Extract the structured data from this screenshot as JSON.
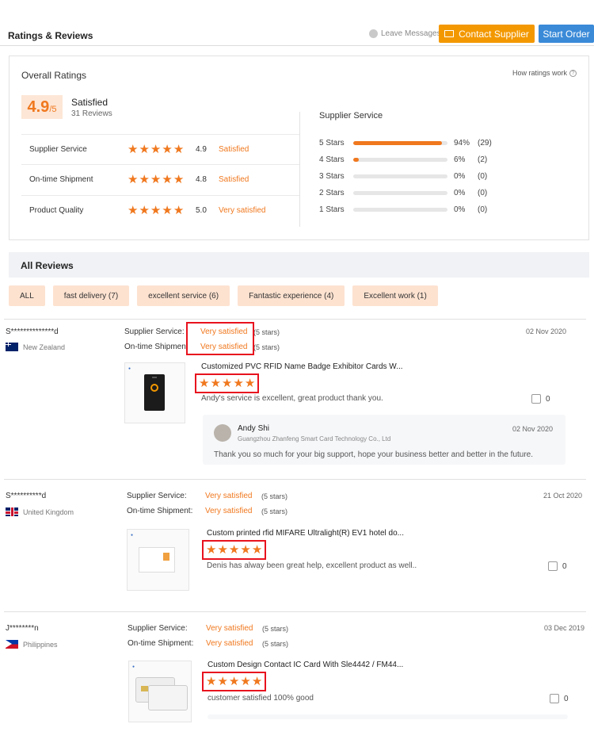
{
  "header": {
    "title": "Ratings & Reviews",
    "leave_messages": "Leave Messages",
    "contact_supplier": "Contact Supplier",
    "start_order": "Start Order"
  },
  "overall": {
    "title": "Overall Ratings",
    "how_ratings_work": "How ratings work",
    "score": "4.9",
    "score_max": "/5",
    "score_label": "Satisfied",
    "reviews_count": "31 Reviews",
    "ratings": [
      {
        "label": "Supplier Service",
        "score": "4.9",
        "desc": "Satisfied",
        "stars": 5
      },
      {
        "label": "On-time Shipment",
        "score": "4.8",
        "desc": "Satisfied",
        "stars": 5
      },
      {
        "label": "Product Quality",
        "score": "5.0",
        "desc": "Very satisfied",
        "stars": 5
      }
    ],
    "service_title": "Supplier Service",
    "distribution": [
      {
        "label": "5 Stars",
        "percent": 94,
        "percent_text": "94%",
        "count": "(29)"
      },
      {
        "label": "4 Stars",
        "percent": 6,
        "percent_text": "6%",
        "count": "(2)"
      },
      {
        "label": "3 Stars",
        "percent": 0,
        "percent_text": "0%",
        "count": "(0)"
      },
      {
        "label": "2 Stars",
        "percent": 0,
        "percent_text": "0%",
        "count": "(0)"
      },
      {
        "label": "1 Stars",
        "percent": 0,
        "percent_text": "0%",
        "count": "(0)"
      }
    ]
  },
  "all_reviews": {
    "title": "All Reviews",
    "filters": [
      "ALL",
      "fast delivery (7)",
      "excellent service (6)",
      "Fantastic experience (4)",
      "Excellent work (1)"
    ]
  },
  "reviews": [
    {
      "name": "S**************d",
      "country": "New Zealand",
      "supplier_service_label": "Supplier Service:",
      "supplier_service_value": "Very satisfied",
      "supplier_service_stars": "(5 stars)",
      "shipment_label": "On-time Shipment:",
      "shipment_value": "Very satisfied",
      "shipment_stars": "(5 stars)",
      "date": "02 Nov 2020",
      "product_title": "Customized PVC RFID Name Badge Exhibitor Cards W...",
      "rating": 5,
      "text": "Andy's service is excellent, great product thank you.",
      "likes": "0",
      "reply": {
        "name": "Andy Shi",
        "company": "Guangzhou Zhanfeng Smart Card Technology Co., Ltd",
        "date": "02 Nov 2020",
        "text": "Thank you so much for your big support, hope your business better and better in the future."
      }
    },
    {
      "name": "S**********d",
      "country": "United Kingdom",
      "supplier_service_label": "Supplier Service:",
      "supplier_service_value": "Very satisfied",
      "supplier_service_stars": "(5 stars)",
      "shipment_label": "On-time Shipment:",
      "shipment_value": "Very satisfied",
      "shipment_stars": "(5 stars)",
      "date": "21 Oct 2020",
      "product_title": "Custom printed rfid MIFARE Ultralight(R) EV1 hotel do...",
      "rating": 5,
      "text": "Denis has alway been great help, excellent product as well..",
      "likes": "0"
    },
    {
      "name": "J********n",
      "country": "Philippines",
      "supplier_service_label": "Supplier Service:",
      "supplier_service_value": "Very satisfied",
      "supplier_service_stars": "(5 stars)",
      "shipment_label": "On-time Shipment:",
      "shipment_value": "Very satisfied",
      "shipment_stars": "(5 stars)",
      "date": "03 Dec 2019",
      "product_title": "Custom Design Contact IC Card With Sle4442 / FM44...",
      "rating": 5,
      "text": "customer satisfied 100% good",
      "likes": "0"
    }
  ],
  "colors": {
    "accent": "#f0781e",
    "contact": "#f39800",
    "order": "#3a8ad8",
    "highlight": "#e8121e"
  },
  "icons": {
    "leave": "chat-bubble-icon",
    "contact": "mail-icon",
    "help": "question-circle-icon",
    "like": "thumbs-up-icon",
    "star": "star-icon"
  },
  "glyphs": {
    "star": "★",
    "question": "?"
  }
}
